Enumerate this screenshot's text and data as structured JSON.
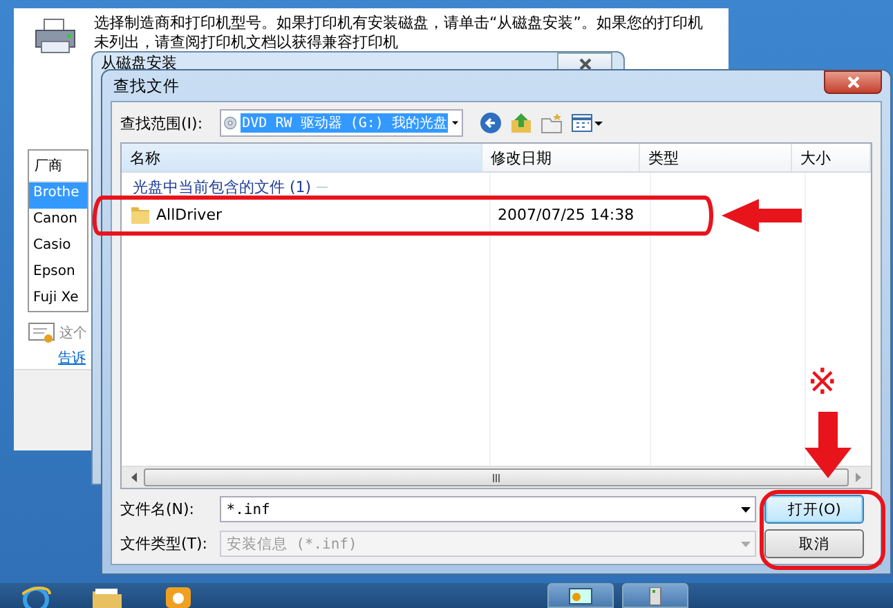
{
  "wizard_window": {
    "instruction_lines": [
      "选择制造商和打印机型号。如果打印机有安装磁盘，请单击“从磁盘安装”。如果您的打印机",
      "未列出，请查阅打印机文档以获得兼容打印机"
    ],
    "manufacturer_list": {
      "header": "厂商",
      "items": [
        {
          "label": "Brothe",
          "selected": true
        },
        {
          "label": "Canon",
          "selected": false
        },
        {
          "label": "Casio",
          "selected": false
        },
        {
          "label": "Epson",
          "selected": false
        },
        {
          "label": "Fuji Xe",
          "selected": false
        }
      ]
    },
    "signed_note": "这个",
    "help_link": "告诉"
  },
  "disk_window": {
    "title": "从磁盘安装"
  },
  "dialog": {
    "title": "查找文件",
    "look_in_label": "查找范围(I):",
    "look_in_value": "DVD RW 驱动器 (G:) 我的光盘",
    "columns": [
      "名称",
      "修改日期",
      "类型",
      "大小"
    ],
    "group": "光盘中当前包含的文件 (1)",
    "rows": [
      {
        "name": "AllDriver",
        "modified": "2007/07/25 14:38"
      }
    ],
    "filename_label": "文件名(N):",
    "filename_value": "*.inf",
    "filetype_label": "文件类型(T):",
    "filetype_value": "安装信息 (*.inf)",
    "filetype_disabled": true,
    "buttons": [
      {
        "label": "打开(O)",
        "kind": "default"
      },
      {
        "label": "取消",
        "kind": "normal"
      }
    ]
  },
  "annotation_mark": "※"
}
